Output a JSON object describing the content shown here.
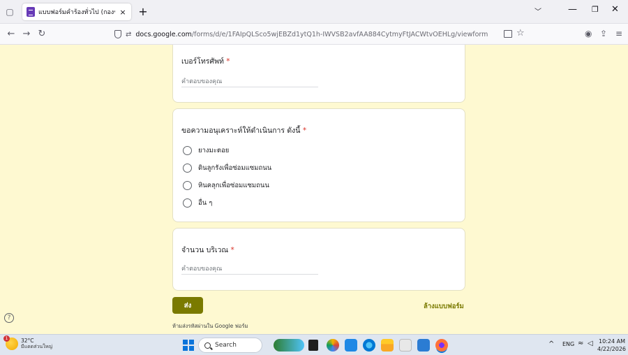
{
  "browser": {
    "tab_title": "แบบฟอร์มคำร้องทั่วไป (กองช่าง)",
    "tab_close": "×",
    "new_tab": "+",
    "url_domain": "docs.google.com",
    "url_path": "/forms/d/e/1FAIpQLSco5wjEBZd1ytQ1h-IWVSB2avfAA884CytmyFtJACWtvOEHLg/viewform"
  },
  "form": {
    "q_phone": {
      "title": "เบอร์โทรศัพท์",
      "required_mark": "*",
      "placeholder": "คำตอบของคุณ"
    },
    "q_request": {
      "title": "ขอความอนุเคราะห์ให้ดำเนินการ ดังนี้",
      "required_mark": "*",
      "options": [
        "ยางมะตอย",
        "ดินลูกรังเพื่อซ่อมแซมถนน",
        "หินคลุกเพื่อซ่อมแซมถนน",
        "อื่น ๆ"
      ]
    },
    "q_area": {
      "title": "จำนวน บริเวณ",
      "required_mark": "*",
      "placeholder": "คำตอบของคุณ"
    },
    "submit_label": "ส่ง",
    "clear_label": "ล้างแบบฟอร์ม",
    "footer_note": "ห้ามส่งรหัสผ่านใน Google ฟอร์ม",
    "accent_color": "#7a7a00",
    "background_color": "#fef9d1"
  },
  "taskbar": {
    "weather_badge": "1",
    "weather_temp": "32°C",
    "weather_cond": "มีแดดส่วนใหญ่",
    "search_label": "Search",
    "lang": "ENG",
    "time": "10:24 AM",
    "date": "4/22/2026"
  }
}
